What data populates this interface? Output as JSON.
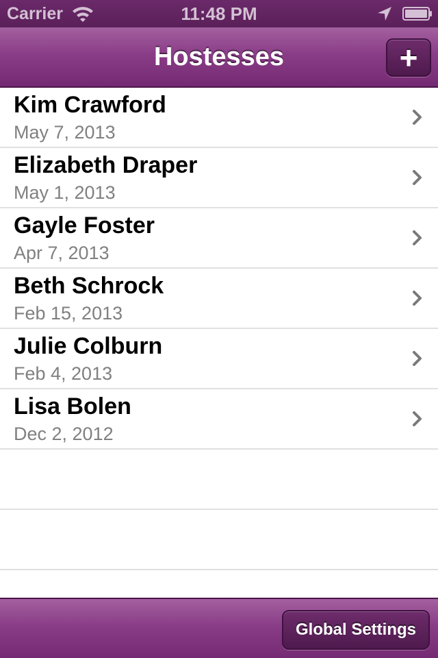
{
  "status_bar": {
    "carrier": "Carrier",
    "time": "11:48 PM",
    "icons": [
      "wifi-icon",
      "location-icon",
      "battery-icon"
    ]
  },
  "nav": {
    "title": "Hostesses",
    "add_label": "+"
  },
  "hostesses": [
    {
      "name": "Kim Crawford",
      "date": "May 7, 2013"
    },
    {
      "name": "Elizabeth Draper",
      "date": "May 1, 2013"
    },
    {
      "name": "Gayle Foster",
      "date": "Apr 7, 2013"
    },
    {
      "name": "Beth Schrock",
      "date": "Feb 15, 2013"
    },
    {
      "name": "Julie Colburn",
      "date": "Feb 4, 2013"
    },
    {
      "name": "Lisa Bolen",
      "date": "Dec 2, 2012"
    }
  ],
  "toolbar": {
    "settings_label": "Global Settings"
  },
  "colors": {
    "bar_top": "#a3609f",
    "bar_bottom": "#742a72",
    "button": "#5e235d",
    "date_text": "#808080",
    "separator": "#e0e0e0"
  }
}
